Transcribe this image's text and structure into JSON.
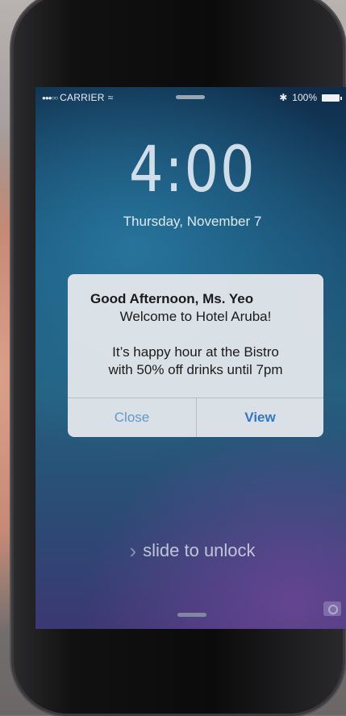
{
  "status_bar": {
    "signal_dots": "●●●○○",
    "carrier": "CARRIER",
    "wifi_icon": "wifi-icon",
    "bluetooth_icon": "bluetooth-icon",
    "battery": "100%"
  },
  "lock_screen": {
    "time": "4:00",
    "date": "Thursday, November 7",
    "slide_chevron": "›",
    "slide_label": "slide to unlock"
  },
  "notification": {
    "title": "Good Afternoon, Ms. Yeo",
    "line1": "Welcome to Hotel Aruba!",
    "line2": "It’s happy hour at the Bistro",
    "line3": "with 50% off drinks until 7pm",
    "close_label": "Close",
    "view_label": "View"
  },
  "colors": {
    "button_blue": "#2f78c8",
    "alert_bg": "#e2e6ea"
  }
}
